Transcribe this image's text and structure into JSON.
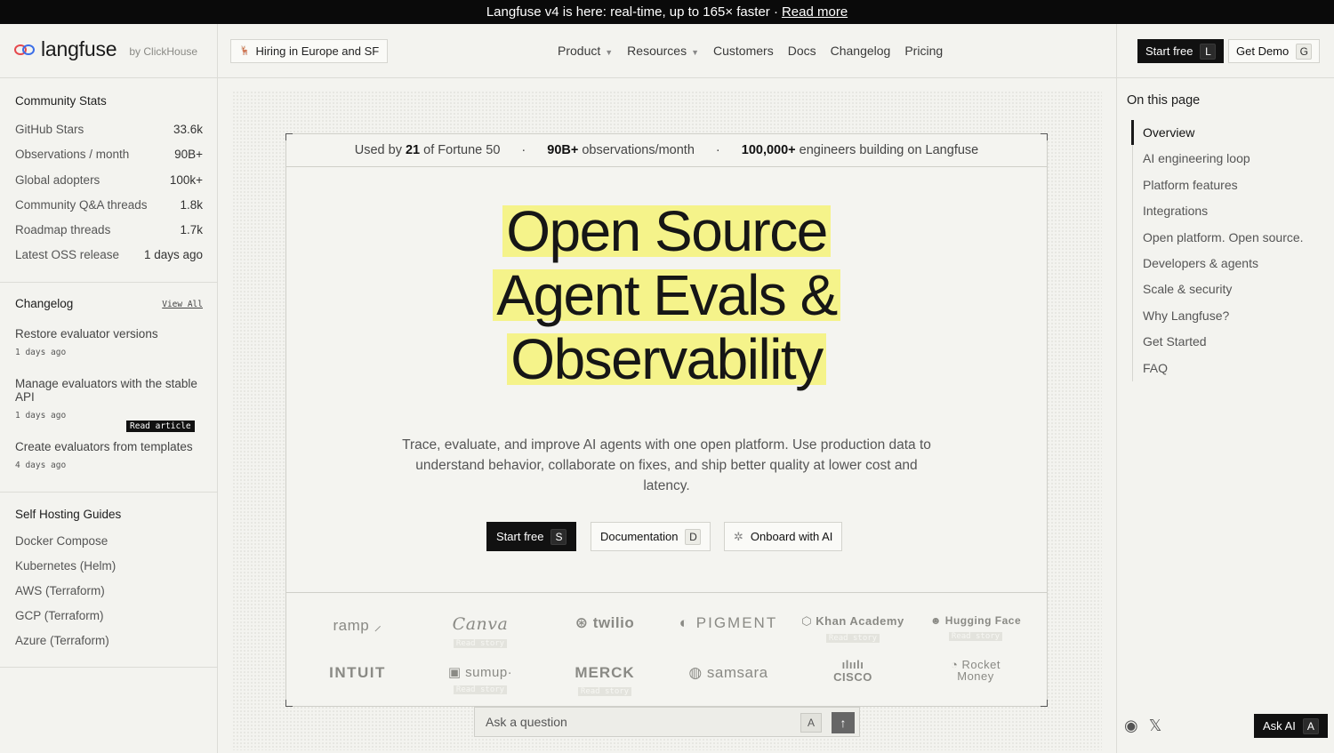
{
  "announcement": {
    "text": "Langfuse v4 is here: real-time, up to 165× faster ·",
    "link": "Read more"
  },
  "header": {
    "logo_text": "langfuse",
    "logo_sub": "by ClickHouse",
    "hiring": "Hiring in Europe and SF",
    "nav": [
      {
        "label": "Product",
        "dropdown": true
      },
      {
        "label": "Resources",
        "dropdown": true
      },
      {
        "label": "Customers",
        "dropdown": false
      },
      {
        "label": "Docs",
        "dropdown": false
      },
      {
        "label": "Changelog",
        "dropdown": false
      },
      {
        "label": "Pricing",
        "dropdown": false
      }
    ],
    "start_free": {
      "label": "Start free",
      "key": "L"
    },
    "get_demo": {
      "label": "Get Demo",
      "key": "G"
    }
  },
  "left": {
    "stats_title": "Community Stats",
    "stats": [
      {
        "label": "GitHub Stars",
        "value": "33.6k"
      },
      {
        "label": "Observations / month",
        "value": "90B+"
      },
      {
        "label": "Global adopters",
        "value": "100k+"
      },
      {
        "label": "Community Q&A threads",
        "value": "1.8k"
      },
      {
        "label": "Roadmap threads",
        "value": "1.7k"
      },
      {
        "label": "Latest OSS release",
        "value": "1 days ago"
      }
    ],
    "changelog_title": "Changelog",
    "view_all": "View All",
    "changelog": [
      {
        "title": "Restore evaluator versions",
        "date": "1 days ago"
      },
      {
        "title": "Manage evaluators with the stable API",
        "date": "1 days ago"
      },
      {
        "title": "Create evaluators from templates",
        "date": "4 days ago"
      }
    ],
    "read_article": "Read article",
    "guides_title": "Self Hosting Guides",
    "guides": [
      "Docker Compose",
      "Kubernetes (Helm)",
      "AWS (Terraform)",
      "GCP (Terraform)",
      "Azure (Terraform)"
    ]
  },
  "main": {
    "strip": {
      "part1_pre": "Used by",
      "part1_num": "21",
      "part1_post": "of Fortune 50",
      "part2_num": "90B+",
      "part2_post": "observations/month",
      "part3_num": "100,000+",
      "part3_post": "engineers building on Langfuse"
    },
    "hero_lines": [
      "Open Source",
      "Agent Evals &",
      "Observability"
    ],
    "subtitle": "Trace, evaluate, and improve AI agents with one open platform. Use production data to understand behavior, collaborate on fixes, and ship better quality at lower cost and latency.",
    "cta": {
      "start": {
        "label": "Start free",
        "key": "S"
      },
      "docs": {
        "label": "Documentation",
        "key": "D"
      },
      "onboard": {
        "label": "Onboard with AI"
      }
    },
    "logos": [
      {
        "name": "ramp ⸝",
        "story": ""
      },
      {
        "name": "Canva",
        "story": "Read story"
      },
      {
        "name": "⊛ twilio",
        "story": ""
      },
      {
        "name": "◐ PIGMENT",
        "story": ""
      },
      {
        "name": "⬡ Khan Academy",
        "story": "Read story"
      },
      {
        "name": "☻ Hugging Face",
        "story": "Read story"
      },
      {
        "name": "INTUIT",
        "story": ""
      },
      {
        "name": "▣ sumup·",
        "story": "Read story"
      },
      {
        "name": "MERCK",
        "story": "Read story"
      },
      {
        "name": "◍ samsara",
        "story": ""
      },
      {
        "name": "ılıılı CISCO",
        "story": ""
      },
      {
        "name": "◔ Rocket Money",
        "story": ""
      }
    ],
    "ask_placeholder": "Ask a question",
    "ask_key": "A"
  },
  "right": {
    "toc_title": "On this page",
    "toc": [
      "Overview",
      "AI engineering loop",
      "Platform features",
      "Integrations",
      "Open platform. Open source.",
      "Developers & agents",
      "Scale & security",
      "Why Langfuse?",
      "Get Started",
      "FAQ"
    ],
    "ask_ai": {
      "label": "Ask AI",
      "key": "A"
    }
  }
}
